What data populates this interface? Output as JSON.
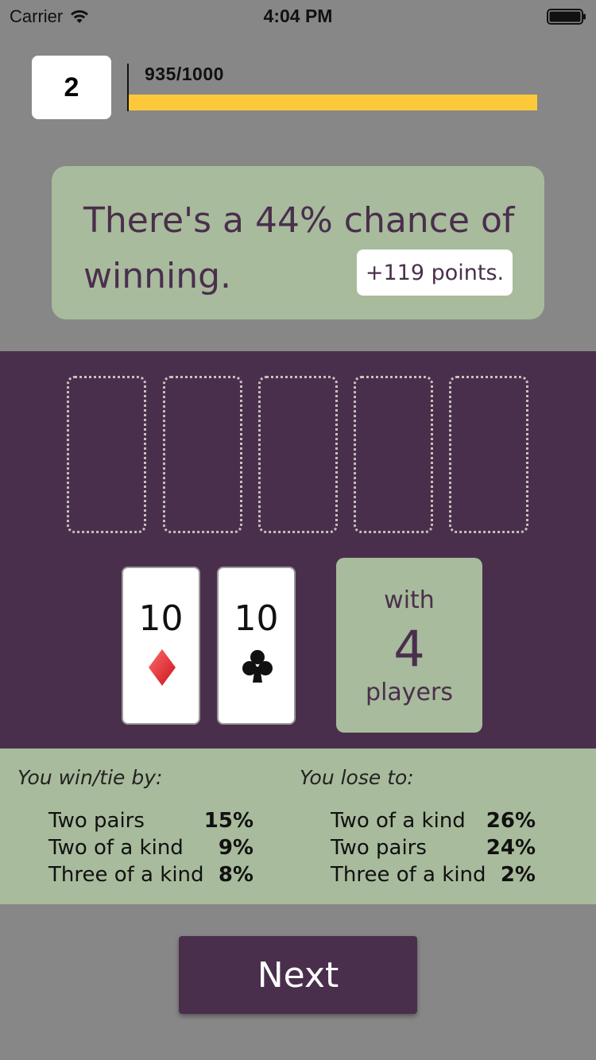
{
  "status_bar": {
    "carrier": "Carrier",
    "time": "4:04 PM",
    "icons": [
      "wifi-icon",
      "battery-icon"
    ]
  },
  "level": "2",
  "progress": {
    "label": "935/1000",
    "current": 935,
    "max": 1000,
    "fill_fraction": 1.0,
    "color": "#fdc93a"
  },
  "chance_panel": {
    "text": "There's a 44% chance of winning.",
    "points": "+119 points."
  },
  "table": {
    "community_slots": 5,
    "hand": [
      {
        "rank": "10",
        "suit": "diamonds",
        "suit_icon": "diamond-icon",
        "color": "#e0262e"
      },
      {
        "rank": "10",
        "suit": "clubs",
        "suit_icon": "club-icon",
        "color": "#111111"
      }
    ],
    "players": {
      "with_label": "with",
      "count": "4",
      "players_label": "players"
    }
  },
  "stats": {
    "win_heading": "You win/tie by:",
    "win_rows": [
      {
        "name": "Two pairs",
        "pct": "15%"
      },
      {
        "name": "Two of a kind",
        "pct": "9%"
      },
      {
        "name": "Three of a kind",
        "pct": "8%"
      }
    ],
    "lose_heading": "You lose to:",
    "lose_rows": [
      {
        "name": "Two of a kind",
        "pct": "26%"
      },
      {
        "name": "Two pairs",
        "pct": "24%"
      },
      {
        "name": "Three of a kind",
        "pct": "2%"
      }
    ]
  },
  "next_button": "Next",
  "colors": {
    "background": "#878787",
    "accent_purple": "#4a2f4d",
    "sage": "#a8bb9c",
    "progress_yellow": "#fdc93a"
  }
}
